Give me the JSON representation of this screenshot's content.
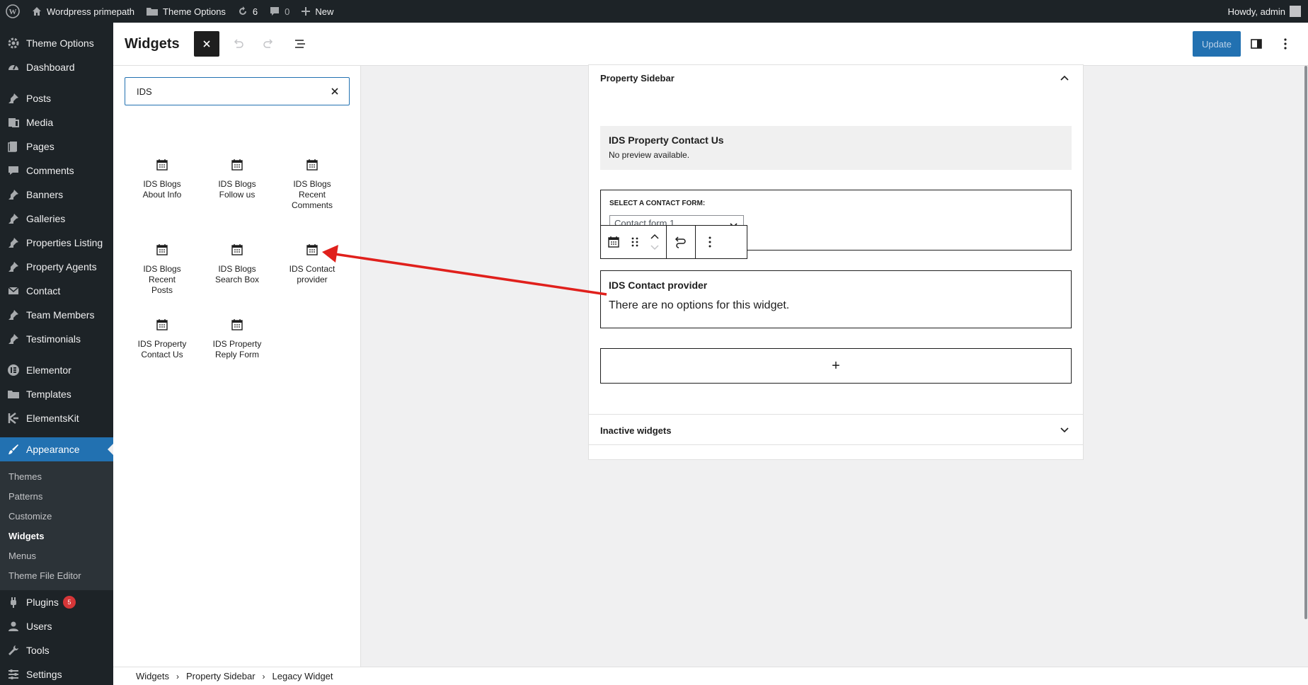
{
  "admin_bar": {
    "site_name": "Wordpress primepath",
    "theme_options": "Theme Options",
    "updates_count": "6",
    "comments_count": "0",
    "new_label": "New",
    "howdy": "Howdy, admin"
  },
  "admin_menu": {
    "items": [
      {
        "label": "Theme Options",
        "icon": "gear-icon"
      },
      {
        "label": "Dashboard",
        "icon": "dashboard-icon"
      },
      {
        "label": "Posts",
        "icon": "pin-icon"
      },
      {
        "label": "Media",
        "icon": "media-icon"
      },
      {
        "label": "Pages",
        "icon": "page-icon"
      },
      {
        "label": "Comments",
        "icon": "comment-icon"
      },
      {
        "label": "Banners",
        "icon": "pin-icon"
      },
      {
        "label": "Galleries",
        "icon": "pin-icon"
      },
      {
        "label": "Properties Listing",
        "icon": "pin-icon"
      },
      {
        "label": "Property Agents",
        "icon": "pin-icon"
      },
      {
        "label": "Contact",
        "icon": "mail-icon"
      },
      {
        "label": "Team Members",
        "icon": "pin-icon"
      },
      {
        "label": "Testimonials",
        "icon": "pin-icon"
      },
      {
        "label": "Elementor",
        "icon": "elementor-icon"
      },
      {
        "label": "Templates",
        "icon": "folder-icon"
      },
      {
        "label": "ElementsKit",
        "icon": "elementskit-icon"
      },
      {
        "label": "Appearance",
        "icon": "brush-icon"
      },
      {
        "label": "Plugins",
        "icon": "plugin-icon",
        "badge": "5"
      },
      {
        "label": "Users",
        "icon": "user-icon"
      },
      {
        "label": "Tools",
        "icon": "wrench-icon"
      },
      {
        "label": "Settings",
        "icon": "settings-icon"
      }
    ],
    "appearance_submenu": [
      "Themes",
      "Patterns",
      "Customize",
      "Widgets",
      "Menus",
      "Theme File Editor"
    ]
  },
  "header": {
    "title": "Widgets",
    "update_label": "Update"
  },
  "inserter": {
    "search_value": "IDS",
    "blocks": [
      {
        "label": "IDS Blogs About Info"
      },
      {
        "label": "IDS Blogs Follow us"
      },
      {
        "label": "IDS Blogs Recent Comments"
      },
      {
        "label": "IDS Blogs Recent Posts"
      },
      {
        "label": "IDS Blogs Search Box"
      },
      {
        "label": "IDS Contact provider"
      },
      {
        "label": "IDS Property Contact Us"
      },
      {
        "label": "IDS Property Reply Form"
      }
    ]
  },
  "canvas": {
    "sidebar_title": "Property Sidebar",
    "preview_title": "IDS Property Contact Us",
    "preview_text": "No preview available.",
    "form_label": "SELECT A CONTACT FORM:",
    "form_value": "Contact form 1",
    "provider_title": "IDS Contact provider",
    "provider_text": "There are no options for this widget.",
    "appender_label": "+",
    "inactive_title": "Inactive widgets"
  },
  "breadcrumb": [
    "Widgets",
    "Property Sidebar",
    "Legacy Widget"
  ],
  "colors": {
    "accent": "#2271b1",
    "admin_bg": "#1d2327",
    "arrow": "#e0201c",
    "badge": "#d63638"
  }
}
